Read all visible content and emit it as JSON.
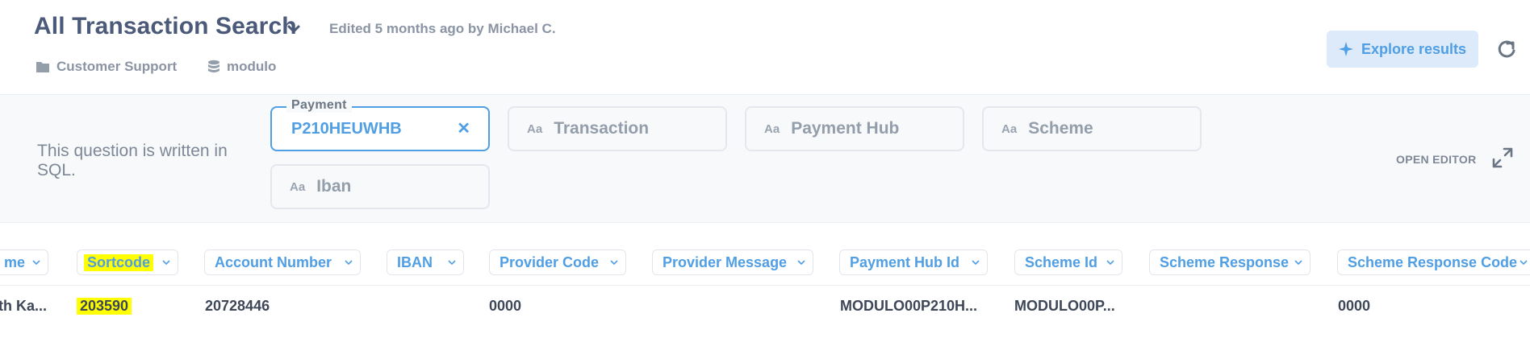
{
  "header": {
    "title": "All Transaction Search",
    "edited": "Edited 5 months ago by Michael C.",
    "collection": "Customer Support",
    "database": "modulo",
    "explore_label": "Explore results"
  },
  "filters": {
    "note": "This question is written in SQL.",
    "payment": {
      "label": "Payment",
      "value": "P210HEUWHB"
    },
    "transaction": {
      "aa": "Aa",
      "placeholder": "Transaction"
    },
    "payment_hub": {
      "aa": "Aa",
      "placeholder": "Payment Hub"
    },
    "scheme": {
      "aa": "Aa",
      "placeholder": "Scheme"
    },
    "iban": {
      "aa": "Aa",
      "placeholder": "Iban"
    },
    "open_editor": "OPEN EDITOR"
  },
  "table": {
    "columns": [
      "me",
      "Sortcode",
      "Account Number",
      "IBAN",
      "Provider Code",
      "Provider Message",
      "Payment Hub Id",
      "Scheme Id",
      "Scheme Response",
      "Scheme Response Code"
    ],
    "row": [
      "th Ka...",
      "203590",
      "20728446",
      "",
      "0000",
      "",
      "MODULO00P210H...",
      "MODULO00P...",
      "",
      "0000"
    ]
  },
  "colors": {
    "accent": "#509ee3",
    "highlight": "#ffff00"
  }
}
